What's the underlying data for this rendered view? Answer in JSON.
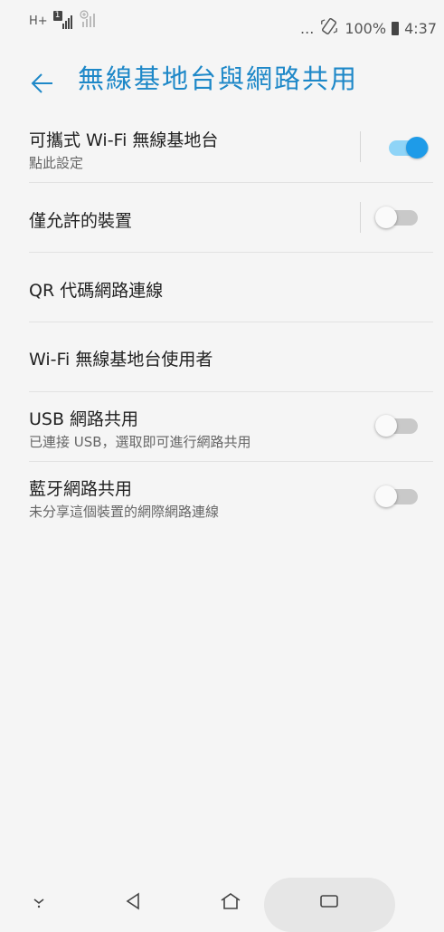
{
  "status_bar": {
    "network_type": "H+",
    "sim_badge": "1",
    "more": "...",
    "battery_percent": "100%",
    "time": "4:37"
  },
  "header": {
    "title": "無線基地台與網路共用"
  },
  "settings": [
    {
      "title": "可攜式 Wi-Fi 無線基地台",
      "subtitle": "點此設定",
      "switch": "on"
    },
    {
      "title": "僅允許的裝置",
      "switch": "off"
    },
    {
      "title": "QR 代碼網路連線"
    },
    {
      "title": "Wi-Fi 無線基地台使用者"
    },
    {
      "title": "USB 網路共用",
      "subtitle": "已連接 USB，選取即可進行網路共用",
      "switch": "off"
    },
    {
      "title": "藍牙網路共用",
      "subtitle": "未分享這個裝置的網際網路連線",
      "switch": "off"
    }
  ],
  "icons": {
    "back": "arrow-left-icon",
    "nav_down": "chevron-down-icon",
    "nav_back": "triangle-back-icon",
    "nav_home": "home-icon",
    "nav_recents": "recents-icon"
  },
  "colors": {
    "accent": "#1e88c8",
    "switch_on_thumb": "#1e9be8",
    "switch_on_track": "#8fd4f7",
    "switch_off_track": "#c9c9c9"
  }
}
